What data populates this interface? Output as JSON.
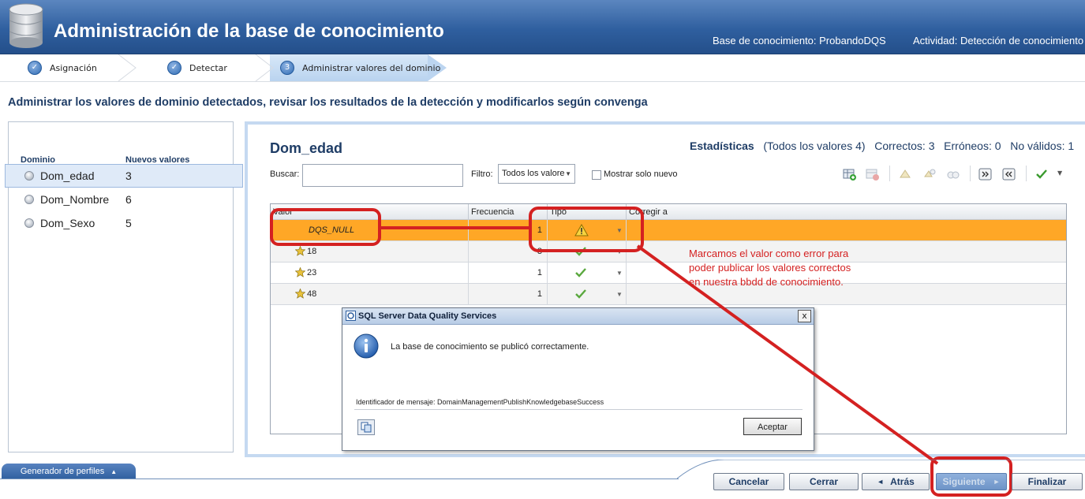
{
  "header": {
    "title": "Administración de la base de conocimiento",
    "kb_label": "Base de conocimiento: ProbandoDQS",
    "activity_label": "Actividad: Detección de conocimiento"
  },
  "wizard": {
    "steps": [
      {
        "label": "Asignación",
        "status": "done"
      },
      {
        "label": "Detectar",
        "status": "done"
      },
      {
        "label": "Administrar valores del dominio",
        "status": "current",
        "number": "3"
      }
    ]
  },
  "instruction": "Administrar los valores de dominio detectados, revisar los resultados de la detección y modificarlos según convenga",
  "left_panel": {
    "col_domain": "Dominio",
    "col_new": "Nuevos valores",
    "domains": [
      {
        "name": "Dom_edad",
        "count": "3"
      },
      {
        "name": "Dom_Nombre",
        "count": "6"
      },
      {
        "name": "Dom_Sexo",
        "count": "5"
      }
    ]
  },
  "main": {
    "domain_title": "Dom_edad",
    "stats": {
      "label": "Estadísticas",
      "all": "(Todos los valores 4)",
      "correct": "Correctos: 3",
      "errors": "Erróneos: 0",
      "invalid": "No válidos: 1"
    },
    "search_label": "Buscar:",
    "search_value": "",
    "filter_label": "Filtro:",
    "filter_value": "Todos los valore",
    "show_new_label": "Mostrar solo nuevo",
    "grid": {
      "headers": [
        "Valor",
        "Frecuencia",
        "Tipo",
        "Corregir a"
      ],
      "rows": [
        {
          "valor": "DQS_NULL",
          "frecuencia": "1",
          "tipo": "warning"
        },
        {
          "valor": "18",
          "frecuencia": "3",
          "tipo": "correct"
        },
        {
          "valor": "23",
          "frecuencia": "1",
          "tipo": "correct"
        },
        {
          "valor": "48",
          "frecuencia": "1",
          "tipo": "correct"
        }
      ]
    }
  },
  "dialog": {
    "title": "SQL Server Data Quality Services",
    "close": "x",
    "message": "La base de conocimiento se publicó correctamente.",
    "message_id": "Identificador de mensaje: DomainManagementPublishKnowledgebaseSuccess",
    "ok": "Aceptar"
  },
  "annotation": {
    "lines": [
      "Marcamos el valor como error para",
      "poder publicar los valores correctos",
      "en nuestra bbdd de conocimiento."
    ],
    "color": "#d42121"
  },
  "bottom": {
    "profiler_tab": "Generador de perfiles",
    "buttons": {
      "cancel": "Cancelar",
      "close": "Cerrar",
      "back": "Atrás",
      "next": "Siguiente",
      "finish": "Finalizar"
    }
  },
  "colors": {
    "header_blue": "#2f5f9f",
    "highlight_orange": "#ffa726",
    "annotation_red": "#d42121"
  }
}
